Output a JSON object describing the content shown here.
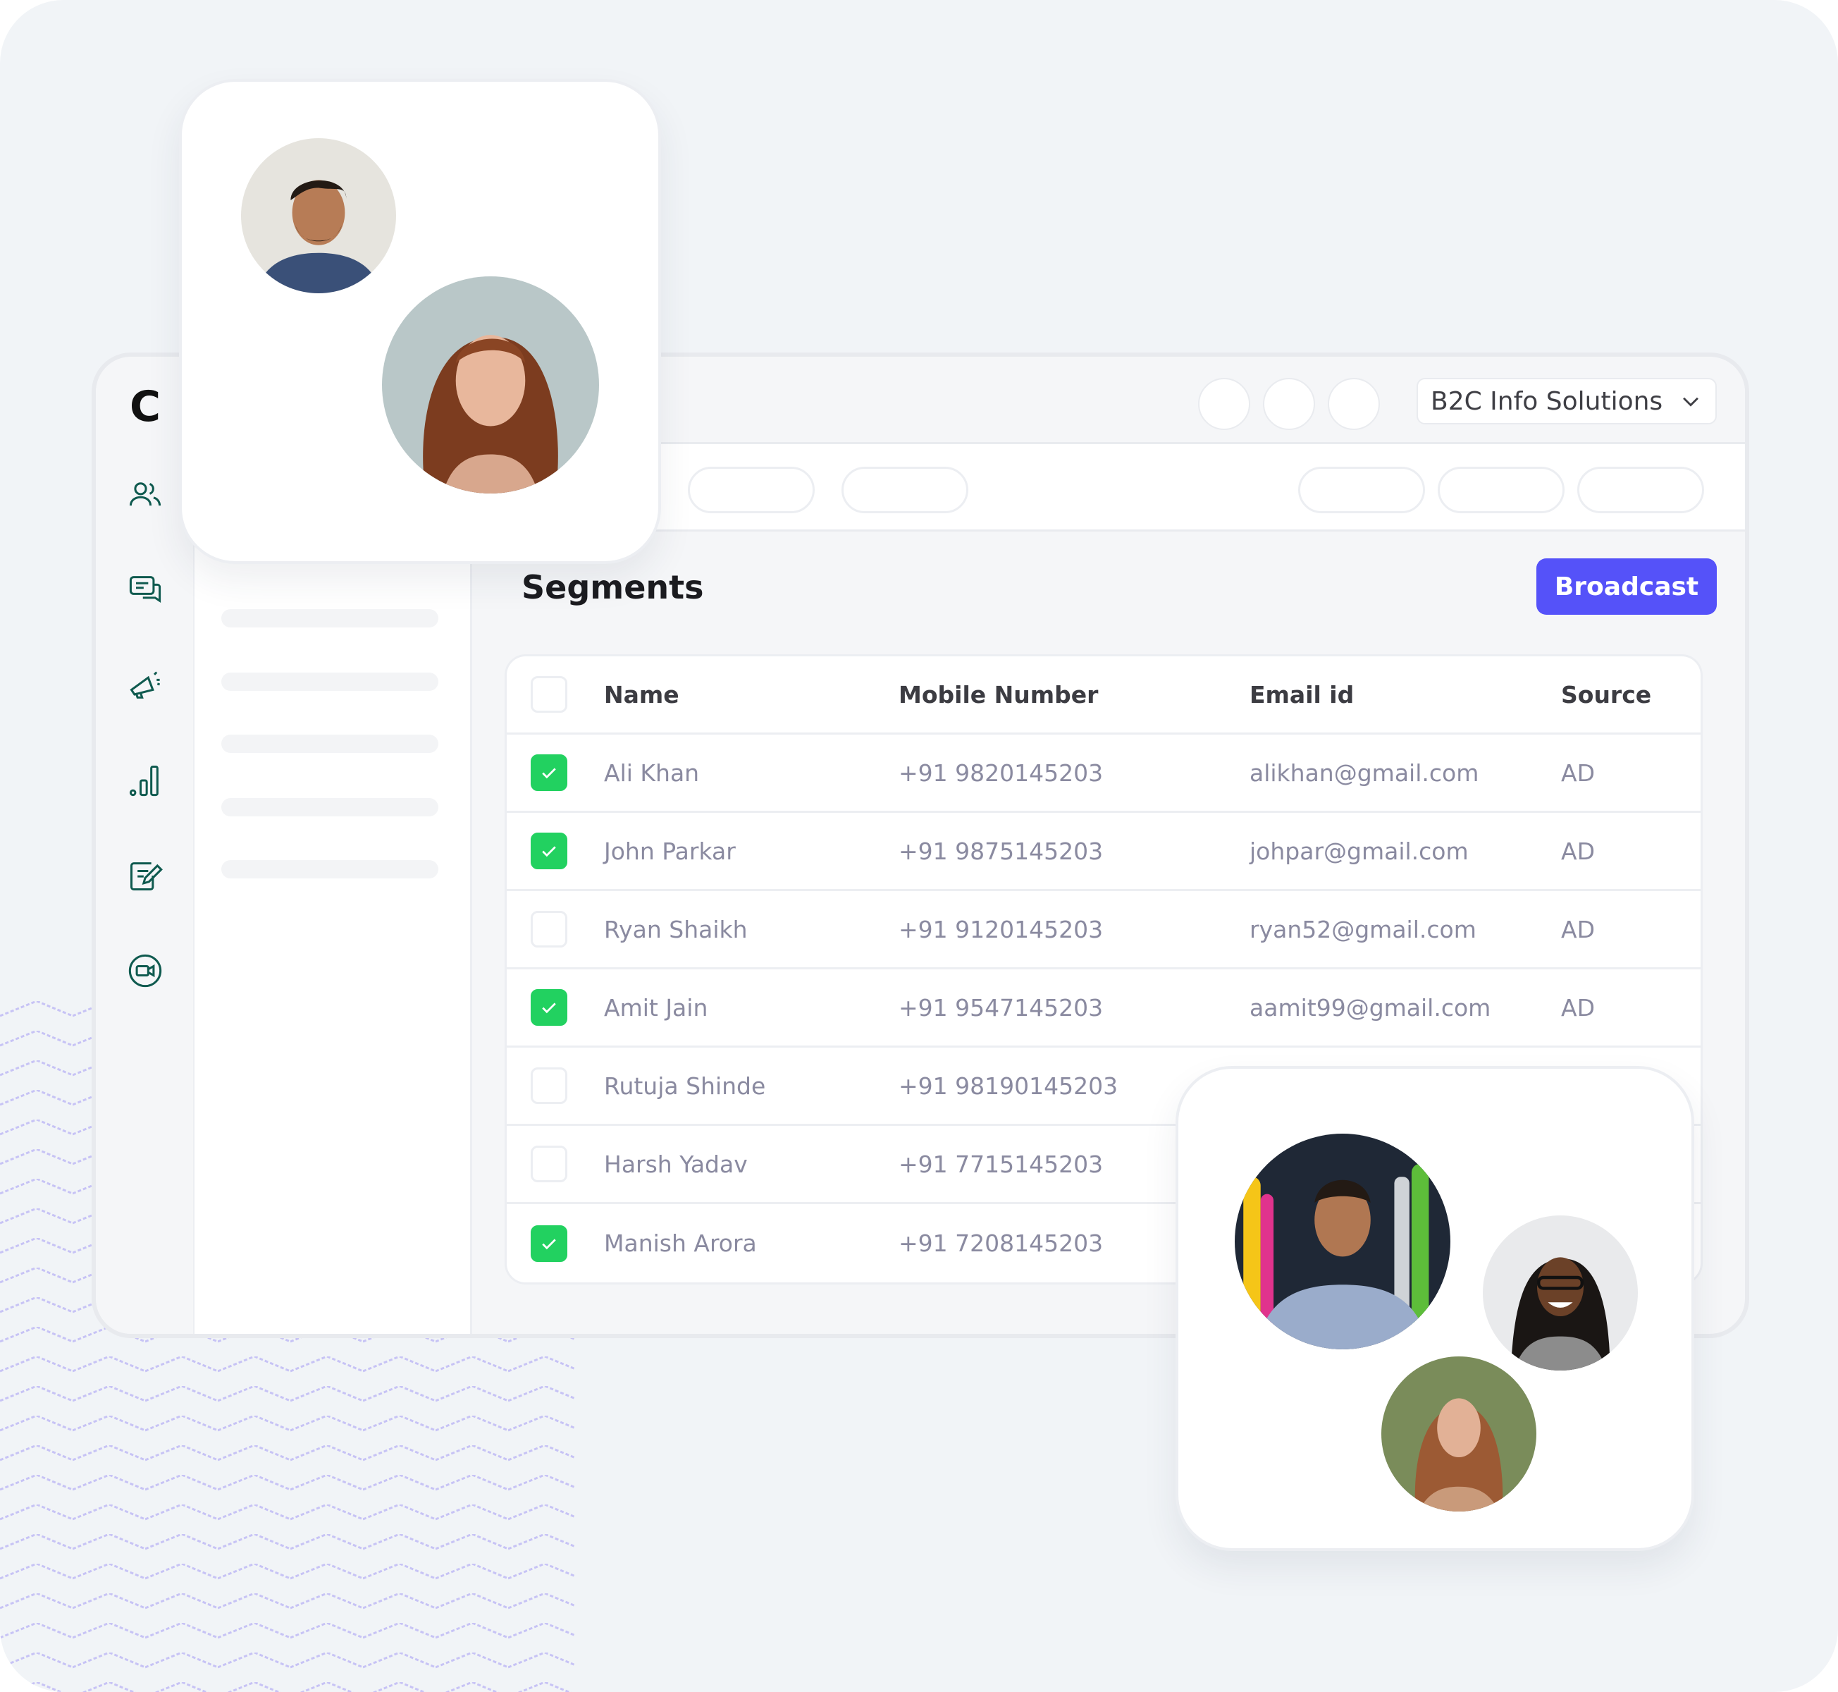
{
  "app": {
    "logo": "C",
    "org_selector": {
      "value": "B2C Info Solutions",
      "icon": "chevron-down-icon"
    },
    "rail_icons": [
      "users-icon",
      "chat-icon",
      "megaphone-icon",
      "bar-chart-icon",
      "edit-note-icon",
      "video-icon"
    ]
  },
  "page": {
    "title": "Segments",
    "broadcast_label": "Broadcast"
  },
  "table": {
    "columns": [
      "Name",
      "Mobile Number",
      "Email id",
      "Source"
    ],
    "rows": [
      {
        "checked": true,
        "name": "Ali Khan",
        "mobile": "+91 9820145203",
        "email": "alikhan@gmail.com",
        "source": "AD"
      },
      {
        "checked": true,
        "name": "John Parkar",
        "mobile": "+91 9875145203",
        "email": "johpar@gmail.com",
        "source": "AD"
      },
      {
        "checked": false,
        "name": "Ryan Shaikh",
        "mobile": "+91 9120145203",
        "email": "ryan52@gmail.com",
        "source": "AD"
      },
      {
        "checked": true,
        "name": "Amit Jain",
        "mobile": "+91 9547145203",
        "email": "aamit99@gmail.com",
        "source": "AD"
      },
      {
        "checked": false,
        "name": "Rutuja Shinde",
        "mobile": "+91 98190145203",
        "email": "",
        "source": ""
      },
      {
        "checked": false,
        "name": "Harsh Yadav",
        "mobile": "+91 7715145203",
        "email": "",
        "source": ""
      },
      {
        "checked": true,
        "name": "Manish Arora",
        "mobile": "+91 7208145203",
        "email": "",
        "source": ""
      }
    ]
  },
  "colors": {
    "accent": "#5552f9",
    "check": "#22d160",
    "icon": "#0f5a4f",
    "zigzag": "#c7c3f5"
  }
}
